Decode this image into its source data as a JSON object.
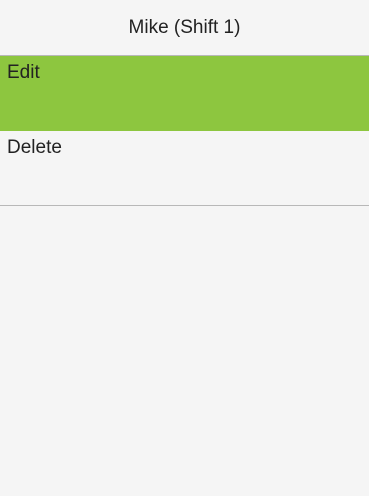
{
  "header": {
    "title": "Mike (Shift 1)"
  },
  "menu": {
    "items": [
      {
        "label": "Edit",
        "selected": true
      },
      {
        "label": "Delete",
        "selected": false
      }
    ],
    "selected_color": "#8dc63f"
  },
  "colors": {
    "background": "#f5f5f5",
    "divider": "#b8b8b8",
    "text": "#222222"
  }
}
